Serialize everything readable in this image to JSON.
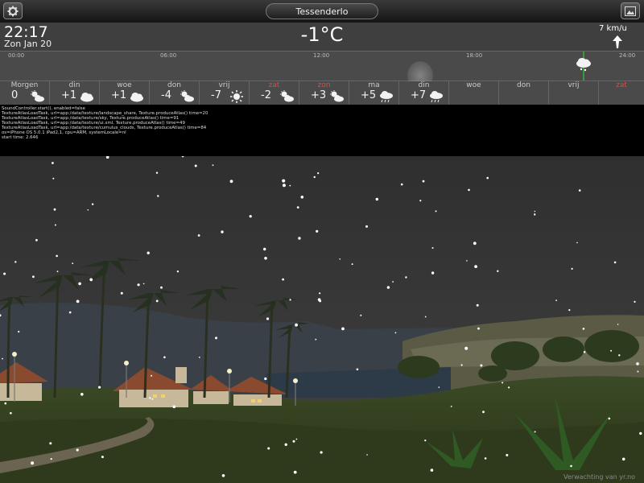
{
  "top_bar": {
    "location": "Tessenderlo"
  },
  "header": {
    "time": "22:17",
    "date": "Zon Jan 20",
    "temperature": "-1°C",
    "wind": "7 km/u"
  },
  "timeline_ticks": [
    "00:00",
    "06:00",
    "12:00",
    "18:00",
    "24:00"
  ],
  "forecast": [
    {
      "day": "Morgen",
      "temp": "0",
      "icon": "partly-cloudy-icon",
      "weekend": false
    },
    {
      "day": "din",
      "temp": "+1",
      "icon": "cloud-icon",
      "weekend": false
    },
    {
      "day": "woe",
      "temp": "+1",
      "icon": "cloud-icon",
      "weekend": false
    },
    {
      "day": "don",
      "temp": "-4",
      "icon": "partly-cloudy-icon",
      "weekend": false
    },
    {
      "day": "vrij",
      "temp": "-7",
      "icon": "sun-icon",
      "weekend": false
    },
    {
      "day": "zat",
      "temp": "-2",
      "icon": "partly-cloudy-icon",
      "weekend": true
    },
    {
      "day": "zon",
      "temp": "+3",
      "icon": "partly-cloudy-icon",
      "weekend": true
    },
    {
      "day": "ma",
      "temp": "+5",
      "icon": "rain-cloud-icon",
      "weekend": false
    },
    {
      "day": "din",
      "temp": "+7",
      "icon": "rain-cloud-icon",
      "weekend": false
    },
    {
      "day": "woe",
      "temp": "",
      "icon": "",
      "weekend": false
    },
    {
      "day": "don",
      "temp": "",
      "icon": "",
      "weekend": false
    },
    {
      "day": "vrij",
      "temp": "",
      "icon": "",
      "weekend": false
    },
    {
      "day": "zat",
      "temp": "",
      "icon": "",
      "weekend": true
    }
  ],
  "debug_log": [
    "SoundController.start(), enabled=false",
    "TextureAtlasLoadTask, url=app:/data/texture/landscape_share, Texture.produceAtlas() time=20",
    "TextureAtlasLoadTask, url=app:/data/texture/sky, Texture.produceAtlas() time=91",
    "TextureAtlasLoadTask, url=app:/data/texture/ui.xml, Texture.produceAtlas() time=49",
    "TextureAtlasLoadTask, url=app:/data/texture/cumulus_clouds, Texture.produceAtlas() time=84",
    "os=iPhone OS 5.0.1 iPad2,1, cpu=ARM, systemLocale=nl",
    "start time: 2.646"
  ],
  "credit": "Verwachting van yr.no",
  "colors": {
    "weekend": "#e04b3c",
    "now_marker": "#3a9a3a",
    "sky": "#343434"
  }
}
